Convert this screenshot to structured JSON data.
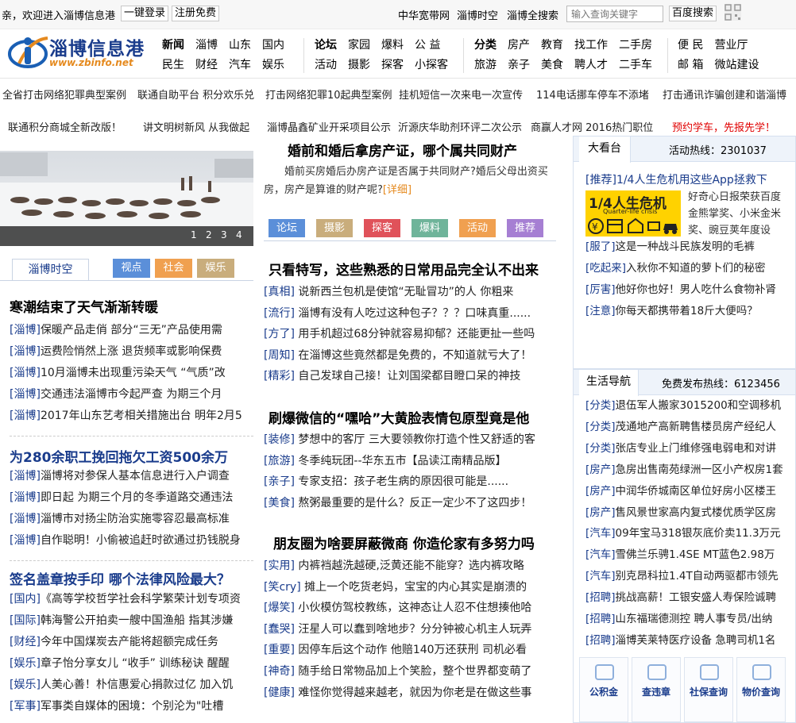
{
  "topbar": {
    "welcome": "亲，欢迎进入淄博信息港",
    "login": "一键登录",
    "register": "注册免费",
    "links": [
      "中华宽带网",
      "淄博时空",
      "淄博全搜索"
    ],
    "search_placeholder": "输入查询关键字",
    "search_button": "百度搜索"
  },
  "logo": {
    "name": "淄博信息港",
    "url": "www.zbinfo.net"
  },
  "nav": {
    "group1_row1": [
      "新闻",
      "淄博",
      "山东",
      "国内"
    ],
    "group1_row2": [
      "民生",
      "财经",
      "汽车",
      "娱乐"
    ],
    "group2_row1": [
      "论坛",
      "家园",
      "爆料",
      "公 益"
    ],
    "group2_row2": [
      "活动",
      "摄影",
      "探客",
      "小探客"
    ],
    "group3_row1": [
      "分类",
      "房产",
      "教育",
      "找工作",
      "二手房"
    ],
    "group3_row2": [
      "旅游",
      "亲子",
      "美食",
      "聘人才",
      "二手车"
    ],
    "group4_row1": [
      "便 民",
      "营业厅"
    ],
    "group4_row2": [
      "邮 箱",
      "微站建设"
    ]
  },
  "ticker": {
    "row1": [
      "全省打击网络犯罪典型案例",
      "联通自助平台 积分欢乐兑",
      "打击网络犯罪10起典型案例",
      "挂机短信一次来电一次宣传",
      "114电话挪车停车不添堵",
      "打击通讯诈骗创建和谐淄博"
    ],
    "row2": [
      "联通积分商城全新改版！",
      "讲文明树新风 从我做起",
      "淄博晶鑫矿业开采项目公示",
      "沂源庆华助剂环评二次公示",
      "商赢人才网 2016热门职位",
      "预约学车，先报先学！"
    ]
  },
  "slideshow": {
    "pages": [
      "1",
      "2",
      "3",
      "4"
    ]
  },
  "left": {
    "tab_label": "淄博时空",
    "tabs": [
      "视点",
      "社会",
      "娱乐"
    ],
    "block1": {
      "title": "寒潮结束了天气渐渐转暖",
      "items": [
        {
          "tag": "[淄博]",
          "text": "保暖产品走俏 部分“三无”产品使用需"
        },
        {
          "tag": "[淄博]",
          "text": "运费险悄然上涨 退货频率或影响保费"
        },
        {
          "tag": "[淄博]",
          "text": "10月淄博未出现重污染天气 “气质”改"
        },
        {
          "tag": "[淄博]",
          "text": "交通违法淄博市今起严查 为期三个月"
        },
        {
          "tag": "[淄博]",
          "text": "2017年山东艺考相关措施出台 明年2月5"
        }
      ]
    },
    "block2": {
      "title": "为280余职工挽回拖欠工资500余万",
      "items": [
        {
          "tag": "[淄博]",
          "text": "淄博将对参保人基本信息进行入户调查"
        },
        {
          "tag": "[淄博]",
          "text": "即日起 为期三个月的冬季道路交通违法"
        },
        {
          "tag": "[淄博]",
          "text": "淄博市对扬尘防治实施零容忍最高标准"
        },
        {
          "tag": "[淄博]",
          "text": "自作聪明！小偷被追赶时欲通过扔钱脱身"
        }
      ]
    },
    "block3": {
      "title": "签名盖章按手印 哪个法律风险最大？",
      "items": [
        {
          "tag": "[国内]",
          "text": "《高等学校哲学社会科学繁荣计划专项资"
        },
        {
          "tag": "[国际]",
          "text": "韩海警公开拍卖一艘中国渔船 指其涉嫌"
        },
        {
          "tag": "[财经]",
          "text": "今年中国煤炭去产能将超额完成任务"
        },
        {
          "tag": "[娱乐]",
          "text": "章子怡分享女儿 “收手” 训练秘诀 醒醒"
        },
        {
          "tag": "[娱乐]",
          "text": "人美心善！朴信惠爱心捐款过亿 加入饥"
        },
        {
          "tag": "[军事]",
          "text": "军事类自媒体的困境：个别沦为\"吐槽"
        }
      ]
    }
  },
  "middle": {
    "headline": "婚前和婚后拿房产证，哪个属共同财产",
    "summary": "婚前买房婚后办房产证是否属于共同财产?婚后父母出资买房，房产是算谁的财产呢?",
    "detail_link": "[详细]",
    "categories": [
      "论坛",
      "摄影",
      "探客",
      "爆料",
      "活动",
      "推荐"
    ],
    "block1": {
      "title": "只看特写，这些熟悉的日常用品完全认不出来",
      "items": [
        {
          "tag": "[真相]",
          "text": " 说新西兰包机是使馆“无耻冒功”的人 你粗来"
        },
        {
          "tag": "[流行]",
          "text": " 淄博有没有人吃过这种包子？？？口味真重......"
        },
        {
          "tag": "[方了]",
          "text": " 用手机超过68分钟就容易抑郁？还能更扯一些吗"
        },
        {
          "tag": "[周知]",
          "text": " 在淄博这些竟然都是免费的，不知道就亏大了！"
        },
        {
          "tag": "[精彩]",
          "text": " 自己发球自己接！让刘国梁都目瞪口呆的神技"
        }
      ]
    },
    "block2": {
      "title": "刷爆微信的“嘿哈”大黄脸表情包原型竟是他",
      "items": [
        {
          "tag": "[装修]",
          "text": " 梦想中的客厅 三大要领教你打造个性又舒适的客"
        },
        {
          "tag": "[旅游]",
          "text": " 冬季纯玩团--华东五市【品读江南精品版】"
        },
        {
          "tag": "[亲子]",
          "text": " 专家支招：孩子老生病的原因很可能是......"
        },
        {
          "tag": "[美食]",
          "text": " 熬粥最重要的是什么？反正一定少不了这四步！"
        }
      ]
    },
    "block3": {
      "title": "朋友圈为啥要屏蔽微商 你造伦家有多努力吗",
      "items": [
        {
          "tag": "[实用]",
          "text": " 内裤裆越洗越硬,泛黄还能不能穿？选内裤攻略"
        },
        {
          "tag": "[笑cry]",
          "text": " 摊上一个吃货老妈，宝宝的内心其实是崩溃的"
        },
        {
          "tag": "[爆笑]",
          "text": " 小伙模仿驾校教练，这神态让人忍不住想揍他哈"
        },
        {
          "tag": "[蠢哭]",
          "text": " 汪星人可以蠢到啥地步？分分钟被心机主人玩弄"
        },
        {
          "tag": "[重要]",
          "text": " 因停车后这个动作 他赔140万还获刑 司机必看"
        },
        {
          "tag": "[神奇]",
          "text": " 随手给日常物品加上个笑脸，整个世界都变萌了"
        },
        {
          "tag": "[健康]",
          "text": " 难怪你觉得越来越老，就因为你老是在做这些事"
        }
      ]
    }
  },
  "right": {
    "box1": {
      "title": "大看台",
      "hotline": "活动热线：2301037",
      "featured_tag": "[推荐]",
      "featured_title": "1/4人生危机用这些App拯救下",
      "image_text": "1/4人生危机",
      "image_sub": "Quarter-life crisis",
      "featured_desc": "好奇心日报荣获百度金熊掌奖、小米金米奖、豌豆荚年度设",
      "items": [
        {
          "tag": "[服了]",
          "text": "这是一种战斗民族发明的毛裤"
        },
        {
          "tag": "[吃起来]",
          "text": "入秋你不知道的萝卜们的秘密"
        },
        {
          "tag": "[厉害]",
          "text": "他好你也好！男人吃什么食物补肾"
        },
        {
          "tag": "[注意]",
          "text": "你每天都携带着18斤大便吗？"
        }
      ]
    },
    "box2": {
      "title": "生活导航",
      "hotline": "免费发布热线：6123456",
      "items": [
        {
          "tag": "[分类]",
          "text": "退伍军人搬家3015200和空调移机"
        },
        {
          "tag": "[分类]",
          "text": "茂通地产高新聘售楼员房产经纪人"
        },
        {
          "tag": "[分类]",
          "text": "张店专业上门维修强电弱电和对讲"
        },
        {
          "tag": "[房产]",
          "text": "急房出售南苑绿洲一区小产权房1套"
        },
        {
          "tag": "[房产]",
          "text": "中润华侨城南区单位好房小区楼王"
        },
        {
          "tag": "[房产]",
          "text": "售风景世家高内复式楼优质学区房"
        },
        {
          "tag": "[汽车]",
          "text": "09年宝马318银灰底价卖11.3万元"
        },
        {
          "tag": "[汽车]",
          "text": "雪佛兰乐骋1.4SE MT蓝色2.98万"
        },
        {
          "tag": "[汽车]",
          "text": "别克昂科拉1.4T自动两驱都市领先"
        },
        {
          "tag": "[招聘]",
          "text": "挑战高薪！工银安盛人寿保险诚聘"
        },
        {
          "tag": "[招聘]",
          "text": "山东福瑞德测控 聘人事专员/出纳"
        },
        {
          "tag": "[招聘]",
          "text": "淄博芙莱特医疗设备 急聘司机1名"
        }
      ]
    },
    "services": [
      "公积金",
      "查违章",
      "社保查询",
      "物价查询"
    ]
  },
  "colors": {
    "brand_blue": "#1a3c8c",
    "tab_blue": "#5b8fd9",
    "tab_orange": "#f0a050",
    "tab_tan": "#c9ad7c",
    "cat_red": "#e0525a",
    "cat_green": "#6fb49a",
    "cat_purple": "#a67fd3",
    "promo_red": "#e00000"
  }
}
